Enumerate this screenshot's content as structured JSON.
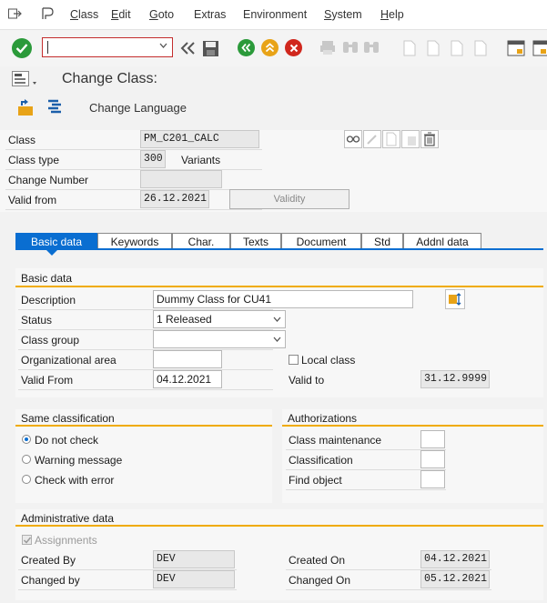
{
  "menubar": {
    "items": [
      {
        "label": "Class",
        "mnemonic": "C",
        "rest": "lass"
      },
      {
        "label": "Edit",
        "mnemonic": "E",
        "rest": "dit"
      },
      {
        "label": "Goto",
        "mnemonic": "G",
        "rest": "oto"
      },
      {
        "label": "Extras",
        "mnemonic": "",
        "rest": "Extras"
      },
      {
        "label": "Environment",
        "mnemonic": "",
        "rest": "Environment"
      },
      {
        "label": "System",
        "mnemonic": "S",
        "rest": "ystem"
      },
      {
        "label": "Help",
        "mnemonic": "H",
        "rest": "elp"
      }
    ]
  },
  "toolbar": {
    "command_value": ""
  },
  "title": "Change Class:",
  "apptoolbar": {
    "change_language": "Change Language"
  },
  "header": {
    "class_label": "Class",
    "class_value": "PM_C201_CALC",
    "class_type_label": "Class type",
    "class_type_value": "300",
    "class_type_text": "Variants",
    "change_number_label": "Change Number",
    "change_number_value": "",
    "valid_from_label": "Valid from",
    "valid_from_value": "26.12.2021",
    "validity_button": "Validity"
  },
  "tabs": [
    "Basic data",
    "Keywords",
    "Char.",
    "Texts",
    "Document",
    "Std",
    "Addnl data"
  ],
  "basic": {
    "title": "Basic data",
    "description_label": "Description",
    "description_value": "Dummy Class for CU41",
    "status_label": "Status",
    "status_value": "1 Released",
    "class_group_label": "Class group",
    "class_group_value": "",
    "org_area_label": "Organizational area",
    "org_area_value": "",
    "local_class_label": "Local class",
    "valid_from_label": "Valid From",
    "valid_from_value": "04.12.2021",
    "valid_to_label": "Valid to",
    "valid_to_value": "31.12.9999"
  },
  "same_classification": {
    "title": "Same classification",
    "opt1": "Do not check",
    "opt2": "Warning message",
    "opt3": "Check with error"
  },
  "authorizations": {
    "title": "Authorizations",
    "class_maintenance": "Class maintenance",
    "classification": "Classification",
    "find_object": "Find object"
  },
  "admin": {
    "title": "Administrative data",
    "assignments_label": "Assignments",
    "created_by_label": "Created By",
    "created_by_value": "DEV",
    "changed_by_label": "Changed by",
    "changed_by_value": "DEV",
    "created_on_label": "Created On",
    "created_on_value": "04.12.2021",
    "changed_on_label": "Changed On",
    "changed_on_value": "05.12.2021"
  },
  "colors": {
    "accent": "#0a6ed1",
    "group_line": "#f0ab00",
    "error": "#c42d2d"
  }
}
